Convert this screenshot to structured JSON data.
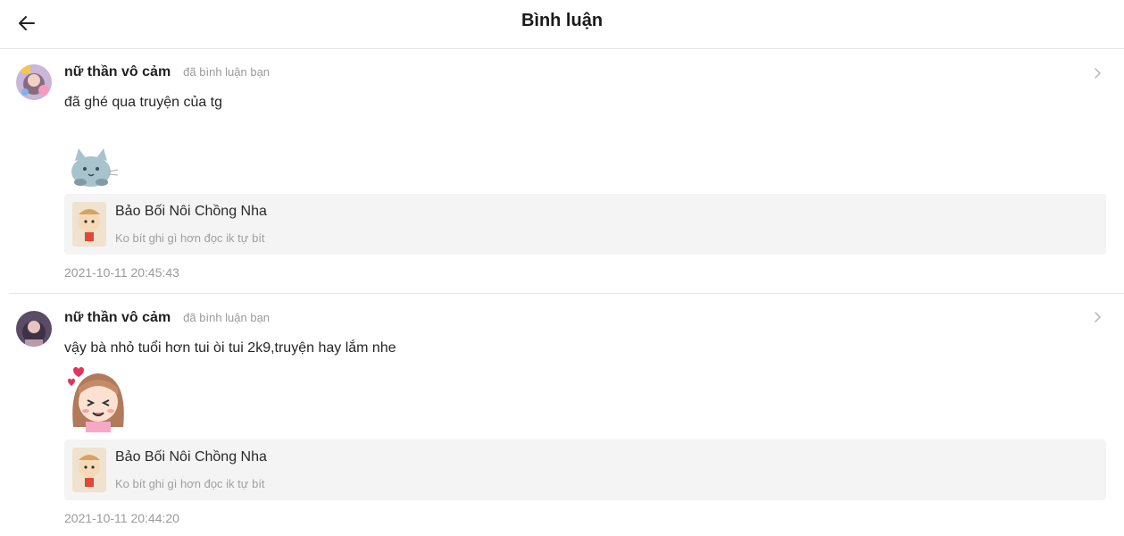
{
  "header": {
    "title": "Bình luận",
    "back_icon": "arrow-left-icon"
  },
  "comments": [
    {
      "username": "nữ thần vô cảm",
      "action": "đã bình luận bạn",
      "text": "đã ghé qua truyện của tg",
      "sticker": "cat-sticker",
      "story": {
        "title": "Bảo Bối Nôi Chồng Nha",
        "description": "Ko bít ghi gì hơn đọc ik tự bít"
      },
      "timestamp": "2021-10-11 20:45:43"
    },
    {
      "username": "nữ thần vô cảm",
      "action": "đã bình luận bạn",
      "text": "vậy bà nhỏ tuổi hơn tui òi tui 2k9,truyện hay lắm nhe",
      "sticker": "girl-hearts-sticker",
      "story": {
        "title": "Bảo Bối Nôi Chồng Nha",
        "description": "Ko bít ghi gì hơn đọc ik tự bít"
      },
      "timestamp": "2021-10-11 20:44:20"
    }
  ],
  "colors": {
    "divider": "#e6e6e6",
    "card_bg": "#f4f4f4",
    "muted_text": "#9b9b9b"
  }
}
